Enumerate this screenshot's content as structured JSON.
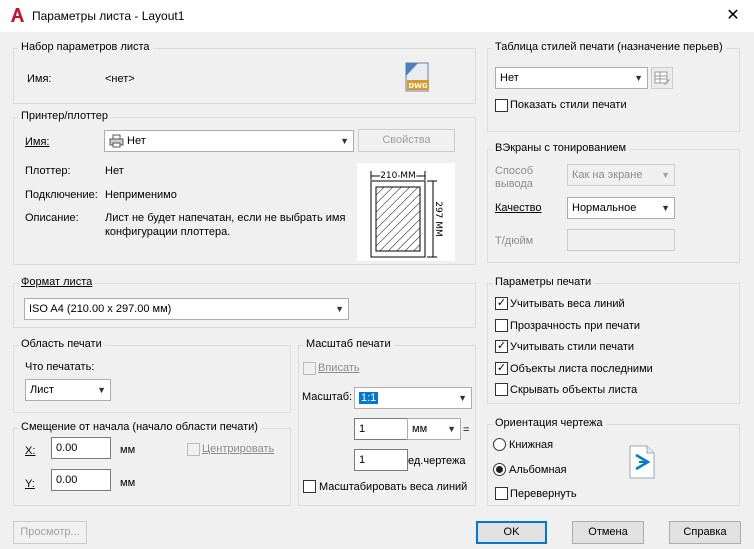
{
  "window": {
    "title": "Параметры листа - Layout1",
    "close": "✕"
  },
  "page_setup": {
    "group_title": "Набор параметров листа",
    "name_label": "Имя:",
    "name_value": "<нет>",
    "dwg_label": "DWG"
  },
  "printer": {
    "group_title": "Принтер/плоттер",
    "name_label": "Имя:",
    "name_value": "Нет",
    "properties_button": "Свойства",
    "plotter_label": "Плоттер:",
    "plotter_value": "Нет",
    "connection_label": "Подключение:",
    "connection_value": "Неприменимо",
    "description_label": "Описание:",
    "description_line1": "Лист не будет напечатан, если не выбрать имя",
    "description_line2": "конфигурации плоттера.",
    "preview_width": "210 MM",
    "preview_height": "297 MM"
  },
  "paper_size": {
    "group_title": "Формат листа",
    "value": "ISO A4 (210.00 x 297.00 мм)"
  },
  "plot_area": {
    "group_title": "Область печати",
    "what_label": "Что печатать:",
    "what_value": "Лист"
  },
  "plot_offset": {
    "group_title": "Смещение от начала (начало области печати)",
    "x_label": "X:",
    "x_value": "0.00",
    "x_unit": "мм",
    "y_label": "Y:",
    "y_value": "0.00",
    "y_unit": "мм",
    "center_label": "Центрировать"
  },
  "plot_scale": {
    "group_title": "Масштаб печати",
    "fit_label": "Вписать",
    "scale_label": "Масштаб:",
    "scale_value": "1:1",
    "value1": "1",
    "unit1": "мм",
    "equals": "=",
    "value2": "1",
    "unit2": "ед.чертежа",
    "lineweights_label": "Масштабировать веса линий"
  },
  "plot_style_table": {
    "group_title": "Таблица стилей печати (назначение перьев)",
    "value": "Нет",
    "show_label": "Показать стили печати"
  },
  "shaded_viewports": {
    "group_title": "ВЭкраны с тонированием",
    "shade_label1": "Способ",
    "shade_label2": "вывода",
    "shade_value": "Как на экране",
    "quality_label": "Качество",
    "quality_value": "Нормальное",
    "dpi_label": "Т/дюйм"
  },
  "plot_options": {
    "group_title": "Параметры печати",
    "items": [
      {
        "label": "Учитывать веса линий",
        "checked": true
      },
      {
        "label": "Прозрачность при печати",
        "checked": false
      },
      {
        "label": "Учитывать стили печати",
        "checked": true
      },
      {
        "label": "Объекты листа последними",
        "checked": true
      },
      {
        "label": "Скрывать объекты листа",
        "checked": false
      }
    ]
  },
  "orientation": {
    "group_title": "Ориентация чертежа",
    "portrait_label": "Книжная",
    "landscape_label": "Альбомная",
    "upside_down_label": "Перевернуть",
    "selected": "landscape"
  },
  "buttons": {
    "preview": "Просмотр...",
    "ok": "OK",
    "cancel": "Отмена",
    "help": "Справка"
  },
  "colors": {
    "accent": "#0078d7",
    "brand_red": "#c8102e"
  }
}
